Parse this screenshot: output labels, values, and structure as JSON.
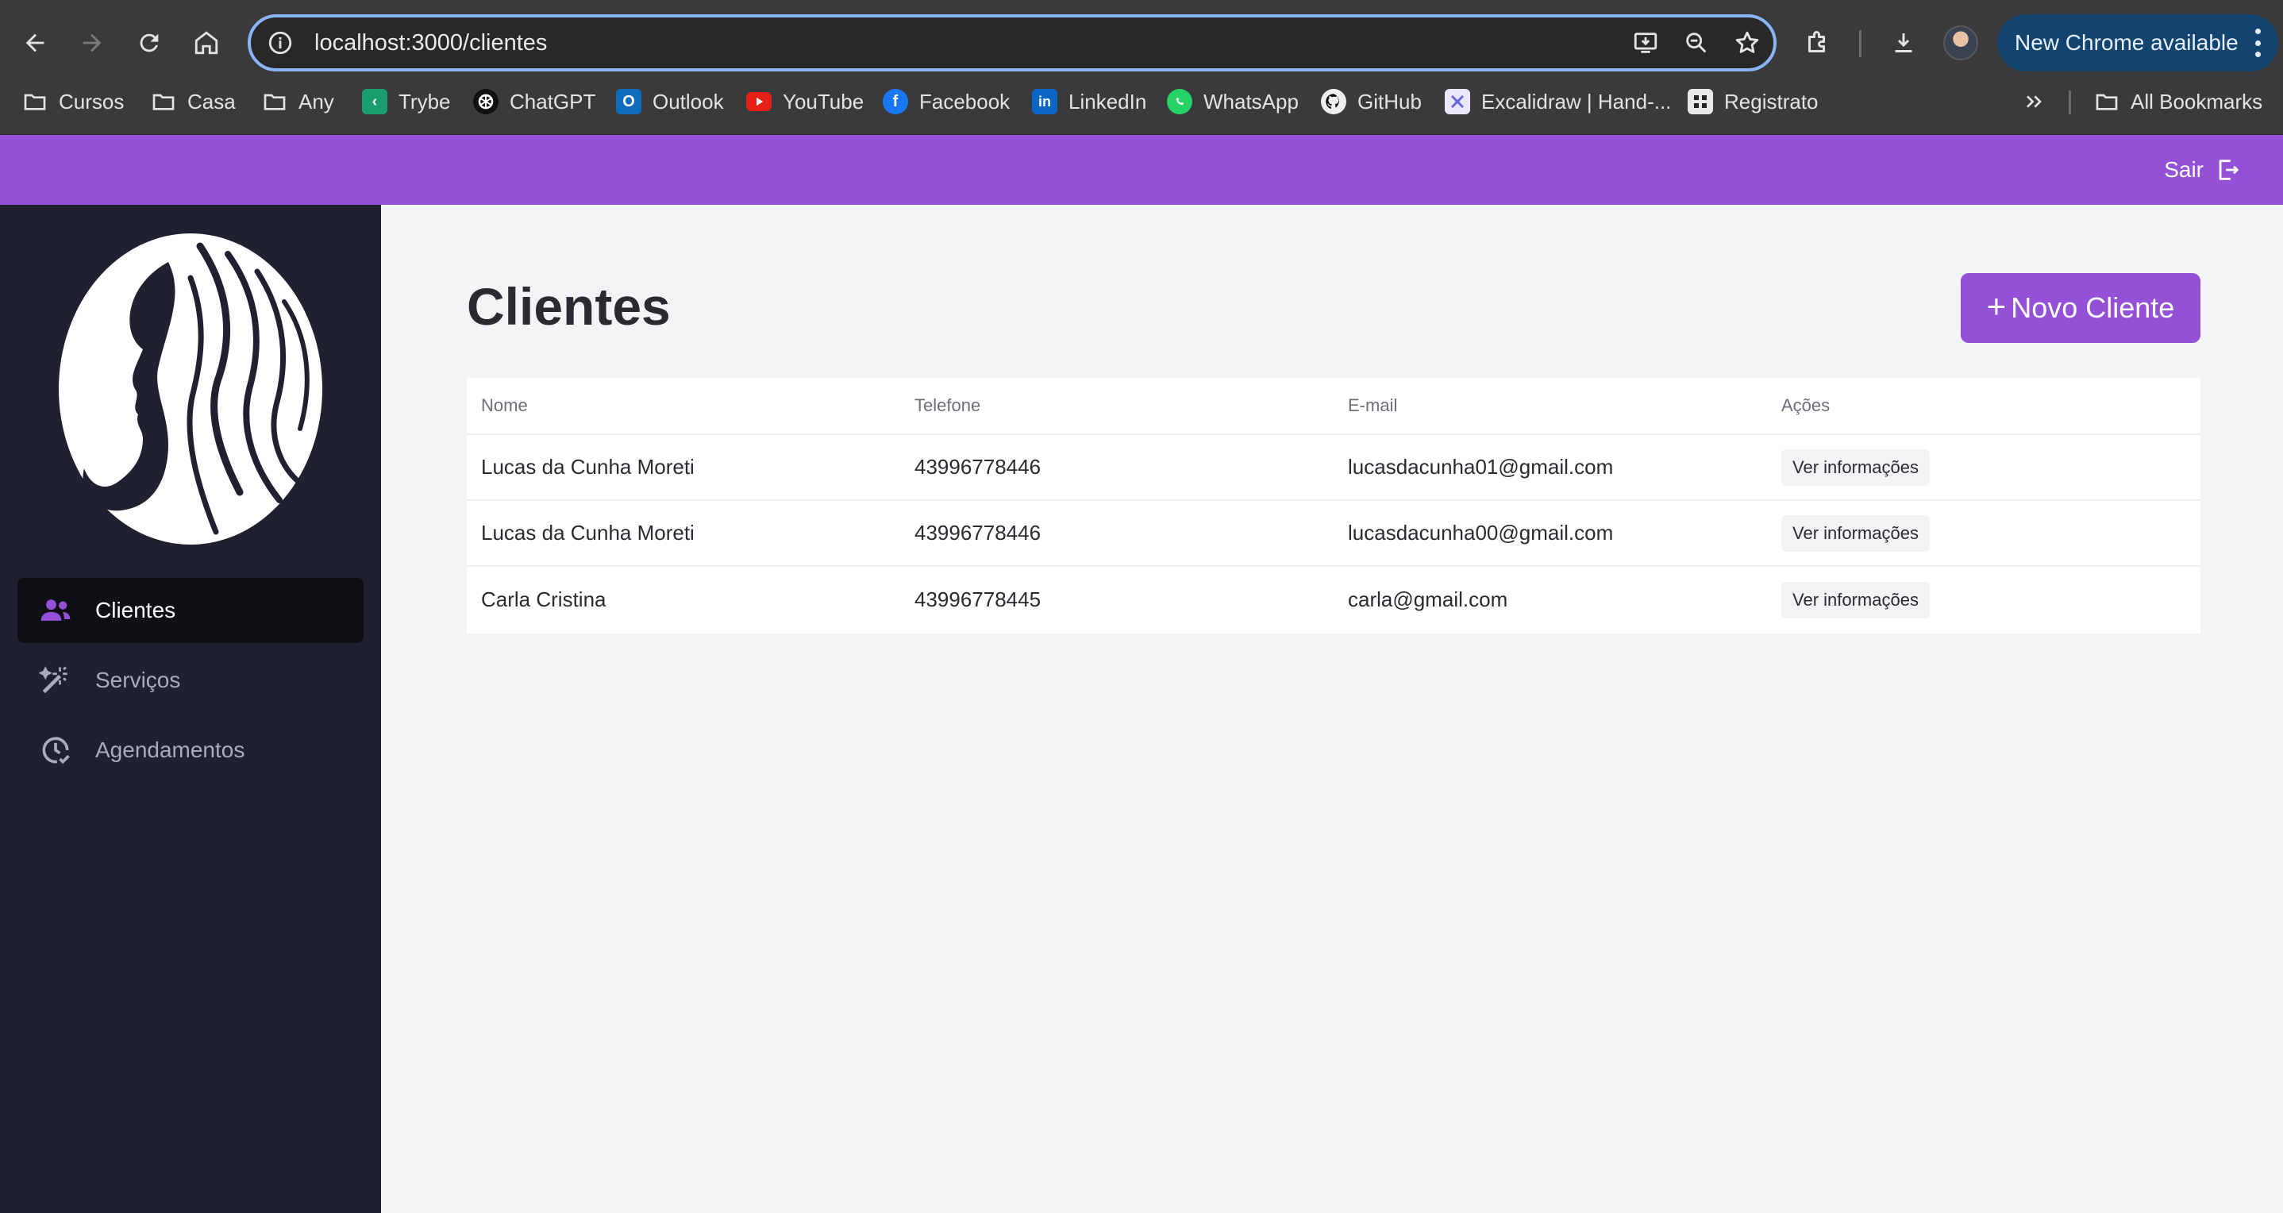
{
  "browser": {
    "url_host": "localhost",
    "url_rest": ":3000/clientes",
    "new_chrome_label": "New Chrome available",
    "bookmarks": [
      {
        "label": "Cursos",
        "icon": "folder-icon"
      },
      {
        "label": "Casa",
        "icon": "folder-icon"
      },
      {
        "label": "Any",
        "icon": "folder-icon"
      },
      {
        "label": "Trybe",
        "icon": "trybe-icon"
      },
      {
        "label": "ChatGPT",
        "icon": "chatgpt-icon"
      },
      {
        "label": "Outlook",
        "icon": "outlook-icon"
      },
      {
        "label": "YouTube",
        "icon": "youtube-icon"
      },
      {
        "label": "Facebook",
        "icon": "facebook-icon"
      },
      {
        "label": "LinkedIn",
        "icon": "linkedin-icon"
      },
      {
        "label": "WhatsApp",
        "icon": "whatsapp-icon"
      },
      {
        "label": "GitHub",
        "icon": "github-icon"
      },
      {
        "label": "Excalidraw | Hand-...",
        "icon": "excalidraw-icon"
      },
      {
        "label": "Registrato",
        "icon": "registrato-icon"
      }
    ],
    "all_bookmarks_label": "All Bookmarks"
  },
  "app": {
    "accent_color": "#9450d6",
    "sidebar_color": "#1f2130",
    "logout_label": "Sair",
    "sidebar": {
      "items": [
        {
          "label": "Clientes",
          "icon": "users-icon",
          "active": true
        },
        {
          "label": "Serviços",
          "icon": "magic-wand-icon",
          "active": false
        },
        {
          "label": "Agendamentos",
          "icon": "clock-check-icon",
          "active": false
        }
      ]
    },
    "page_title": "Clientes",
    "new_client_label": "Novo Cliente",
    "table": {
      "headers": [
        "Nome",
        "Telefone",
        "E-mail",
        "Ações"
      ],
      "rows": [
        {
          "nome": "Lucas da Cunha Moreti",
          "telefone": "43996778446",
          "email": "lucasdacunha01@gmail.com",
          "acao": "Ver informações"
        },
        {
          "nome": "Lucas da Cunha Moreti",
          "telefone": "43996778446",
          "email": "lucasdacunha00@gmail.com",
          "acao": "Ver informações"
        },
        {
          "nome": "Carla Cristina",
          "telefone": "43996778445",
          "email": "carla@gmail.com",
          "acao": "Ver informações"
        }
      ]
    }
  }
}
